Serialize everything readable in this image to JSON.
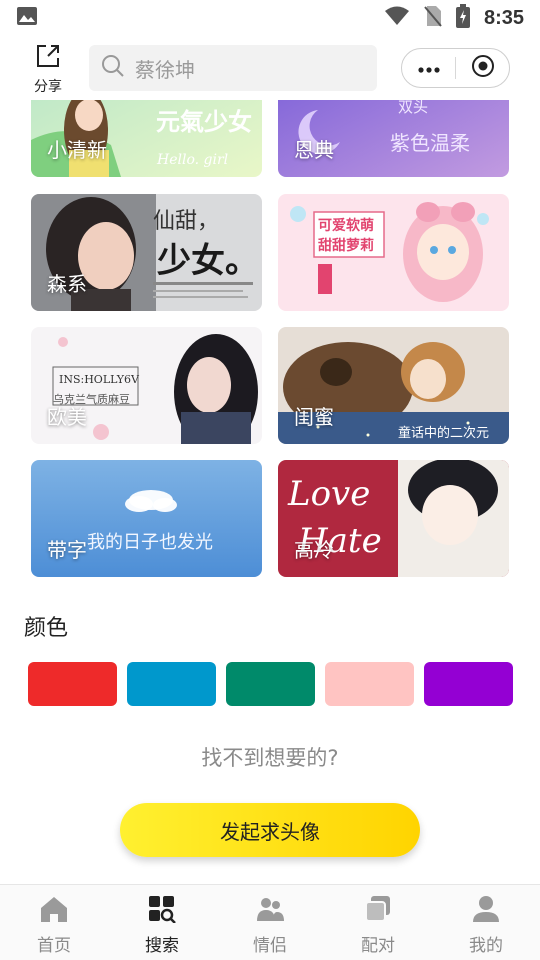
{
  "status_bar": {
    "time": "8:35"
  },
  "top_bar": {
    "share_label": "分享",
    "search_placeholder": "蔡徐坤"
  },
  "style_cards": [
    {
      "label": "小清新",
      "overlay_text": "元氣少女",
      "sub_text": "Hello. girl"
    },
    {
      "label": "恩典",
      "overlay_text": "紫色温柔",
      "sub_text": "双头"
    },
    {
      "label": "森系",
      "overlay_text": "仙甜，",
      "sub_text": "少女。"
    },
    {
      "label": "",
      "overlay_text": "可爱软萌",
      "sub_text": "甜甜萝莉"
    },
    {
      "label": "欧美",
      "overlay_text": "INS:HOLLY6V",
      "sub_text": "乌克兰气质麻豆"
    },
    {
      "label": "闺蜜",
      "overlay_text": "童话中的二次元",
      "sub_text": ""
    },
    {
      "label": "带字",
      "overlay_text": "我的日子也发光",
      "sub_text": ""
    },
    {
      "label": "高冷",
      "overlay_text": "Love",
      "sub_text": "Hate"
    }
  ],
  "colors_section": {
    "title": "颜色",
    "swatches": [
      "#ee2a2a",
      "#0098cc",
      "#008a6a",
      "#ffc4c2",
      "#9400d3"
    ]
  },
  "not_found_text": "找不到想要的?",
  "request_button_label": "发起求头像",
  "bottom_nav": [
    {
      "label": "首页",
      "icon": "home-icon",
      "active": false
    },
    {
      "label": "搜索",
      "icon": "search-grid-icon",
      "active": true
    },
    {
      "label": "情侣",
      "icon": "couple-icon",
      "active": false
    },
    {
      "label": "配对",
      "icon": "match-icon",
      "active": false
    },
    {
      "label": "我的",
      "icon": "user-icon",
      "active": false
    }
  ],
  "accent_color": "#ffd400"
}
